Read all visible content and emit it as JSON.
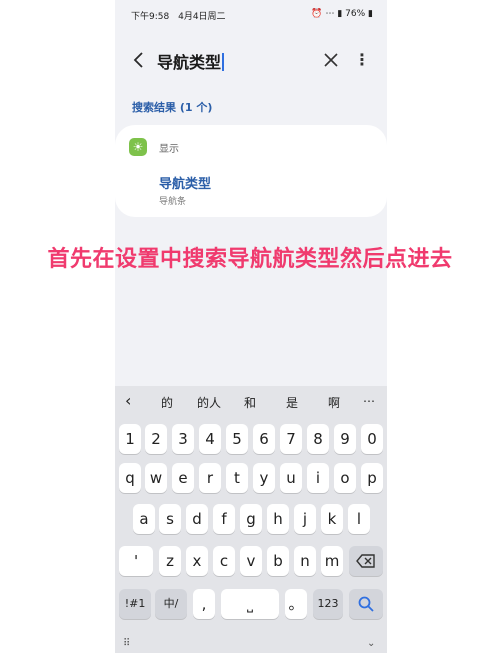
{
  "status": {
    "time": "下午9:58",
    "date": "4月4日周二",
    "battery": "76%"
  },
  "search": {
    "query": "导航类型"
  },
  "results_label": "搜索结果 (1 个)",
  "result": {
    "category": "显示",
    "title": "导航类型",
    "subtitle": "导航条"
  },
  "overlay_text": "首先在设置中搜索导航航类型然后点进去",
  "suggestions": [
    "的",
    "的人",
    "和",
    "是",
    "啊"
  ],
  "keys": {
    "numbers": [
      "1",
      "2",
      "3",
      "4",
      "5",
      "6",
      "7",
      "8",
      "9",
      "0"
    ],
    "row1": [
      "q",
      "w",
      "e",
      "r",
      "t",
      "y",
      "u",
      "i",
      "o",
      "p"
    ],
    "row2": [
      "a",
      "s",
      "d",
      "f",
      "g",
      "h",
      "j",
      "k",
      "l"
    ],
    "row3": [
      "'",
      "z",
      "x",
      "c",
      "v",
      "b",
      "n",
      "m"
    ],
    "sym": "!#1",
    "lang": "中/",
    "comma": ",",
    "period": "。",
    "num": "123"
  },
  "icons": [
    "back-icon",
    "close-icon",
    "more-icon",
    "settings-sun-icon",
    "backspace-icon",
    "search-icon",
    "hide-keyboard-icon"
  ]
}
